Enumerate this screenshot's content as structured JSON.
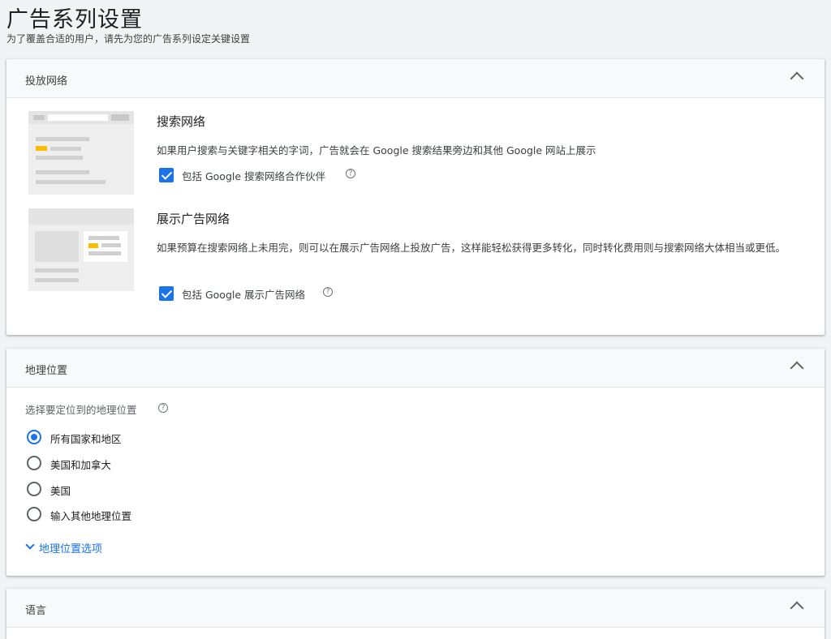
{
  "page": {
    "title": "广告系列设置",
    "subtitle": "为了覆盖合适的用户，请先为您的广告系列设定关键设置"
  },
  "network_card": {
    "header": "投放网络",
    "search": {
      "title": "搜索网络",
      "description": "如果用户搜索与关键字相关的字词，广告就会在 Google 搜索结果旁边和其他 Google 网站上展示",
      "checkbox_label": "包括 Google 搜索网络合作伙伴",
      "checked": true
    },
    "display": {
      "title": "展示广告网络",
      "description": "如果预算在搜索网络上未用完，则可以在展示广告网络上投放广告，这样能轻松获得更多转化，同时转化费用则与搜索网络大体相当或更低。",
      "checkbox_label": "包括 Google 展示广告网络",
      "checked": true
    },
    "help_glyph": "?"
  },
  "location_card": {
    "header": "地理位置",
    "prompt": "选择要定位到的地理位置",
    "options": [
      {
        "label": "所有国家和地区",
        "checked": true
      },
      {
        "label": "美国和加拿大",
        "checked": false
      },
      {
        "label": "美国",
        "checked": false
      },
      {
        "label": "输入其他地理位置",
        "checked": false
      }
    ],
    "more_link": "地理位置选项"
  },
  "language_card": {
    "header": "语言"
  },
  "colors": {
    "accent": "#1a73e8",
    "illustration_yellow": "#fbbc04"
  }
}
